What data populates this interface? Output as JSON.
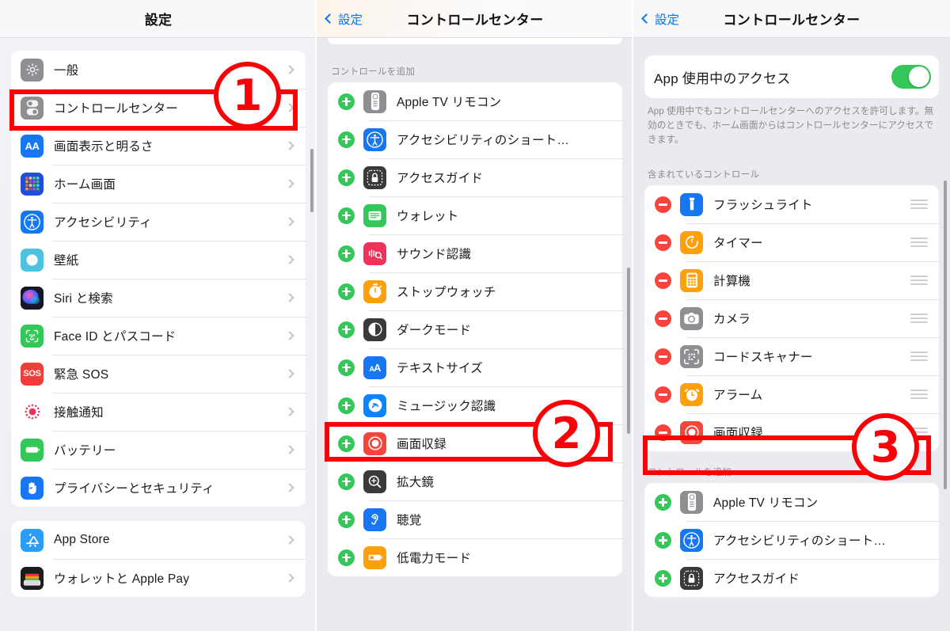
{
  "panel1": {
    "navbar": {
      "title": "設定"
    },
    "groups": [
      {
        "rows": [
          {
            "label": "一般",
            "icon": "gear-icon",
            "color": "#8e8e93"
          },
          {
            "label": "コントロールセンター",
            "icon": "control-center-icon",
            "color": "#8e8e93"
          },
          {
            "label": "画面表示と明るさ",
            "icon": "display-brightness-icon",
            "color": "#1777f2"
          },
          {
            "label": "ホーム画面",
            "icon": "home-screen-icon",
            "color": "#1f4fd8"
          },
          {
            "label": "アクセシビリティ",
            "icon": "accessibility-icon",
            "color": "#1777f2"
          },
          {
            "label": "壁紙",
            "icon": "wallpaper-icon",
            "color": "#4ec3e0"
          },
          {
            "label": "Siri と検索",
            "icon": "siri-icon",
            "color": "#2a2a35"
          },
          {
            "label": "Face ID とパスコード",
            "icon": "face-id-icon",
            "color": "#34c759"
          },
          {
            "label": "緊急 SOS",
            "icon": "sos-icon",
            "color": "#f03e3a"
          },
          {
            "label": "接触通知",
            "icon": "exposure-notification-icon",
            "color": "#ffffff"
          },
          {
            "label": "バッテリー",
            "icon": "battery-icon",
            "color": "#34c759"
          },
          {
            "label": "プライバシーとセキュリティ",
            "icon": "privacy-hand-icon",
            "color": "#1777f2"
          }
        ]
      },
      {
        "rows": [
          {
            "label": "App Store",
            "icon": "app-store-icon",
            "color": "#2b9df4"
          },
          {
            "label": "ウォレットと Apple Pay",
            "icon": "wallet-icon",
            "color": "#1c1c1e"
          }
        ]
      }
    ]
  },
  "panel2": {
    "navbar": {
      "back_label": "設定",
      "title": "コントロールセンター"
    },
    "section_header": "コントロールを追加",
    "rows": [
      {
        "label": "Apple TV リモコン",
        "icon": "apple-tv-remote-icon",
        "color": "#8e8e93",
        "action": "add"
      },
      {
        "label": "アクセシビリティのショート…",
        "icon": "accessibility-icon",
        "color": "#1777f2",
        "action": "add"
      },
      {
        "label": "アクセスガイド",
        "icon": "guided-access-icon",
        "color": "#3a3a3c",
        "action": "add"
      },
      {
        "label": "ウォレット",
        "icon": "wallet-card-icon",
        "color": "#34c759",
        "action": "add"
      },
      {
        "label": "サウンド認識",
        "icon": "sound-recognition-icon",
        "color": "#f0325b",
        "action": "add"
      },
      {
        "label": "ストップウォッチ",
        "icon": "stopwatch-icon",
        "color": "#ff9f0a",
        "action": "add"
      },
      {
        "label": "ダークモード",
        "icon": "dark-mode-icon",
        "color": "#3a3a3c",
        "action": "add"
      },
      {
        "label": "テキストサイズ",
        "icon": "text-size-icon",
        "color": "#1777f2",
        "action": "add"
      },
      {
        "label": "ミュージック認識",
        "icon": "shazam-icon",
        "color": "#0a84ff",
        "action": "add"
      },
      {
        "label": "画面収録",
        "icon": "screen-record-icon",
        "color": "#f7453c",
        "action": "add"
      },
      {
        "label": "拡大鏡",
        "icon": "magnifier-icon",
        "color": "#3a3a3c",
        "action": "add"
      },
      {
        "label": "聴覚",
        "icon": "hearing-icon",
        "color": "#1777f2",
        "action": "add"
      },
      {
        "label": "低電力モード",
        "icon": "low-power-icon",
        "color": "#ff9f0a",
        "action": "add"
      }
    ]
  },
  "panel3": {
    "navbar": {
      "back_label": "設定",
      "title": "コントロールセンター"
    },
    "access_row": {
      "label": "App 使用中のアクセス",
      "toggle_on": true,
      "toggle_color": "#34c759"
    },
    "footnote": "App 使用中でもコントロールセンターへのアクセスを許可します。無効のときでも、ホーム画面からはコントロールセンターにアクセスできます。",
    "included_header": "含まれているコントロール",
    "included_rows": [
      {
        "label": "フラッシュライト",
        "icon": "flashlight-icon",
        "color": "#1777f2",
        "action": "remove"
      },
      {
        "label": "タイマー",
        "icon": "timer-icon",
        "color": "#ff9f0a",
        "action": "remove"
      },
      {
        "label": "計算機",
        "icon": "calculator-icon",
        "color": "#ff9f0a",
        "action": "remove"
      },
      {
        "label": "カメラ",
        "icon": "camera-icon",
        "color": "#8e8e93",
        "action": "remove"
      },
      {
        "label": "コードスキャナー",
        "icon": "code-scanner-icon",
        "color": "#8e8e93",
        "action": "remove"
      },
      {
        "label": "アラーム",
        "icon": "alarm-icon",
        "color": "#ff9f0a",
        "action": "remove"
      },
      {
        "label": "画面収録",
        "icon": "screen-record-icon",
        "color": "#f7453c",
        "action": "remove"
      }
    ],
    "add_header": "コントロールを追加",
    "add_rows": [
      {
        "label": "Apple TV リモコン",
        "icon": "apple-tv-remote-icon",
        "color": "#8e8e93",
        "action": "add"
      },
      {
        "label": "アクセシビリティのショート…",
        "icon": "accessibility-icon",
        "color": "#1777f2",
        "action": "add"
      },
      {
        "label": "アクセスガイド",
        "icon": "guided-access-icon",
        "color": "#3a3a3c",
        "action": "add"
      }
    ]
  },
  "annotations": {
    "accent": "#fb0007",
    "markers": [
      {
        "number": "1"
      },
      {
        "number": "2"
      },
      {
        "number": "3"
      }
    ]
  }
}
